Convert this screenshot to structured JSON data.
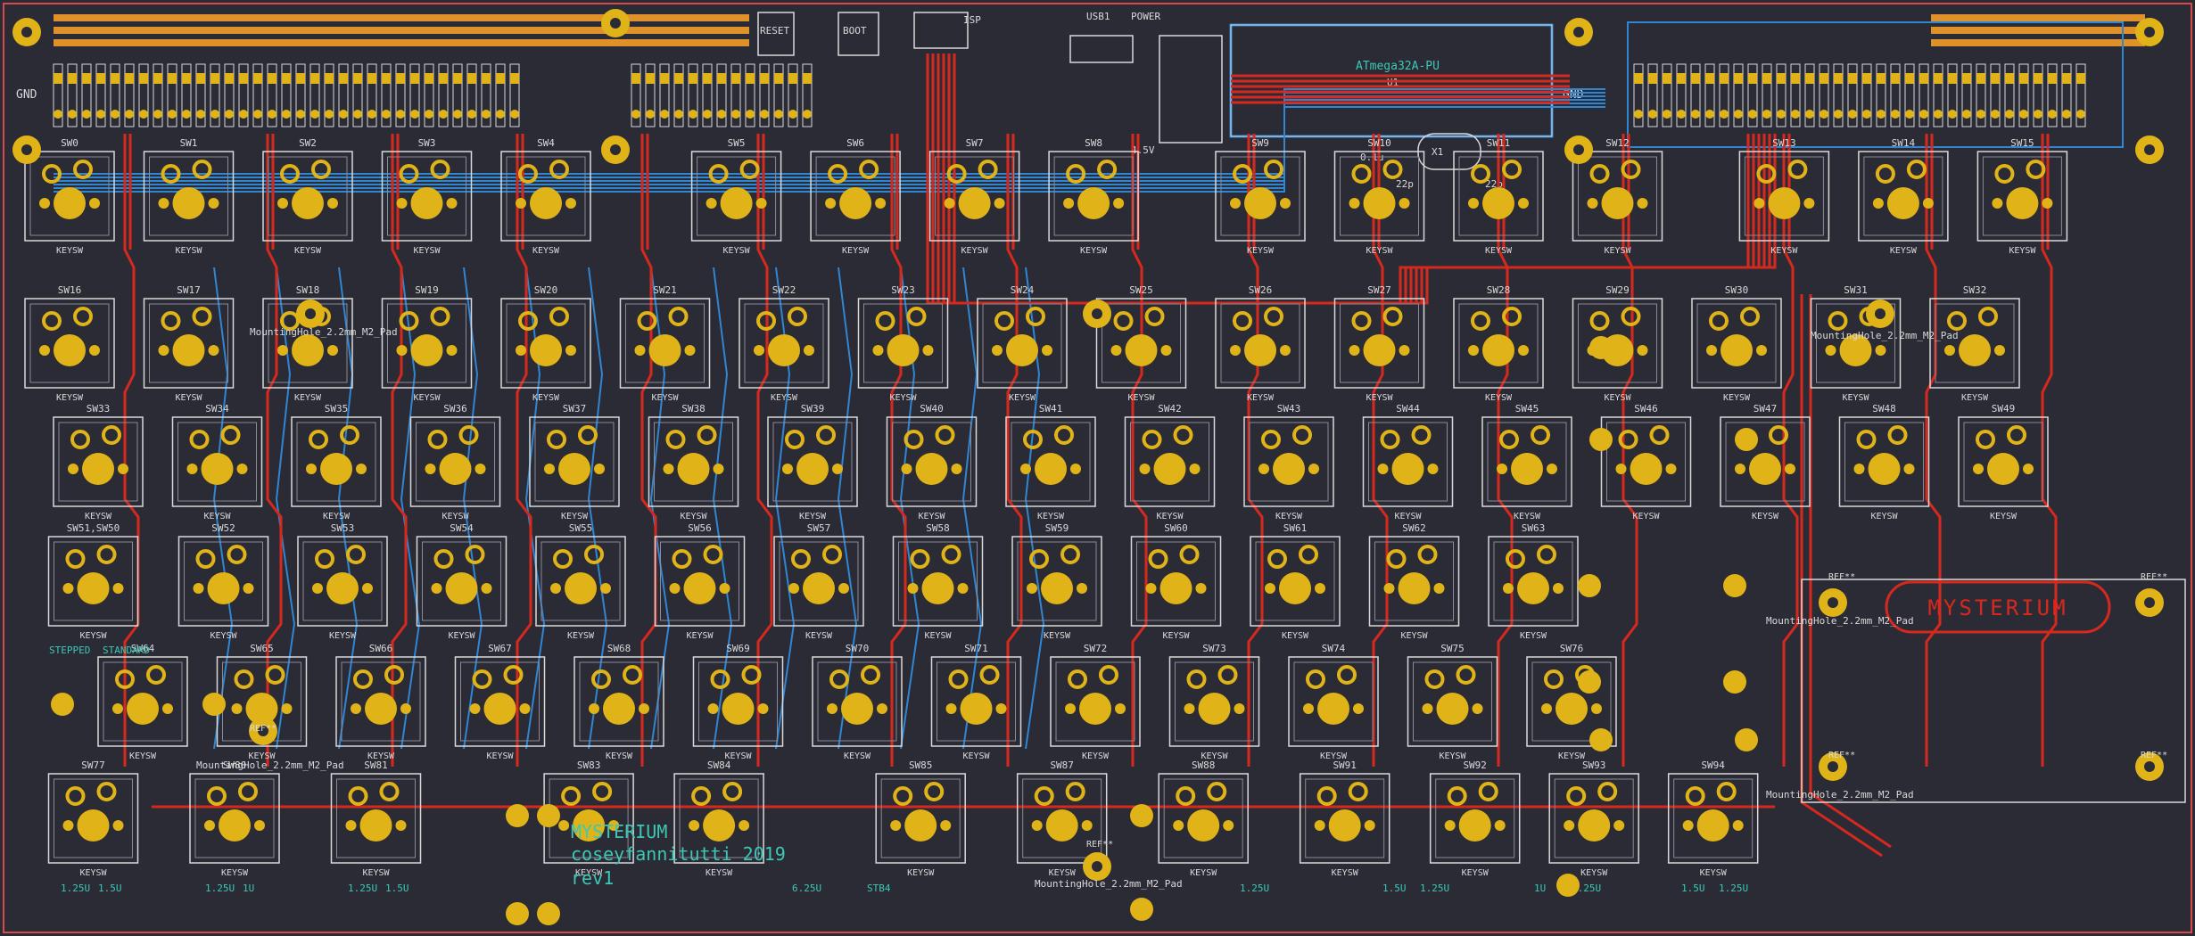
{
  "title_block": {
    "name": "MYSTERIUM",
    "author_year": "coseyfannitutti 2019",
    "revision": "rev1"
  },
  "logo_text": "MYSTERIUM",
  "component_labels": {
    "mcu": "ATmega32A-PU",
    "mcu_ref": "U1",
    "reset": "RESET",
    "boot": "BOOT",
    "power": "POWER",
    "usb": "USB1",
    "isp": "ISP",
    "crystal": "X1",
    "resistor_label": "4.5V",
    "cap_a": "22p",
    "cap_b": "22p",
    "cap_c": "0.1u",
    "stepped": "STEPPED",
    "standard": "STANDARD",
    "ref_marker": "REF**",
    "gnd": "GND"
  },
  "mounting_hole_label": "MountingHole_2.2mm_M2_Pad",
  "switch_footprint_label": "KEYSW",
  "switch_rows": [
    [
      "SW0",
      "SW1",
      "SW2",
      "SW3",
      "SW4",
      "SW5",
      "SW6",
      "SW7",
      "SW8",
      "SW9",
      "SW10",
      "SW11",
      "SW12",
      "SW13",
      "SW14",
      "SW15"
    ],
    [
      "SW16",
      "SW17",
      "SW18",
      "SW19",
      "SW20",
      "SW21",
      "SW22",
      "SW23",
      "SW24",
      "SW25",
      "SW26",
      "SW27",
      "SW28",
      "SW29",
      "SW30",
      "SW31",
      "SW32"
    ],
    [
      "SW33",
      "SW34",
      "SW35",
      "SW36",
      "SW37",
      "SW38",
      "SW39",
      "SW40",
      "SW41",
      "SW42",
      "SW43",
      "SW44",
      "SW45",
      "SW46",
      "SW47",
      "SW48",
      "SW49"
    ],
    [
      "SW51,SW50",
      "SW52",
      "SW53",
      "SW54",
      "SW55",
      "SW56",
      "SW57",
      "SW58",
      "SW59",
      "SW60",
      "SW61",
      "SW62",
      "SW63"
    ],
    [
      "SW64",
      "SW65",
      "SW66",
      "SW67",
      "SW68",
      "SW69",
      "SW70",
      "SW71",
      "SW72",
      "SW73",
      "SW74",
      "SW75",
      "SW76"
    ],
    [
      "SW77",
      "SW80",
      "SW81",
      "SW83",
      "SW84",
      "SW85",
      "SW87",
      "SW88",
      "SW91",
      "SW92",
      "SW93",
      "SW94"
    ]
  ],
  "stab_labels": [
    [
      "1.25U",
      "1.5U"
    ],
    [
      "1.25U",
      "1U"
    ],
    [
      "1.25U",
      "1.5U"
    ],
    [
      "6.25U",
      ""
    ],
    [
      "STB4",
      ""
    ],
    [
      "1.25U",
      ""
    ],
    [
      "1.5U",
      "1.25U"
    ],
    [
      "1U",
      "1.25U"
    ],
    [
      "1.5U",
      "1.25U"
    ]
  ],
  "colors": {
    "board": "#2b2b36",
    "copper_front": "#d7281e",
    "copper_back": "#2f86d2",
    "pad": "#e0b318",
    "silkscreen": "#d9d9d9",
    "edge_cuts": "#d94a4a",
    "title_text": "#3cc8b4"
  }
}
